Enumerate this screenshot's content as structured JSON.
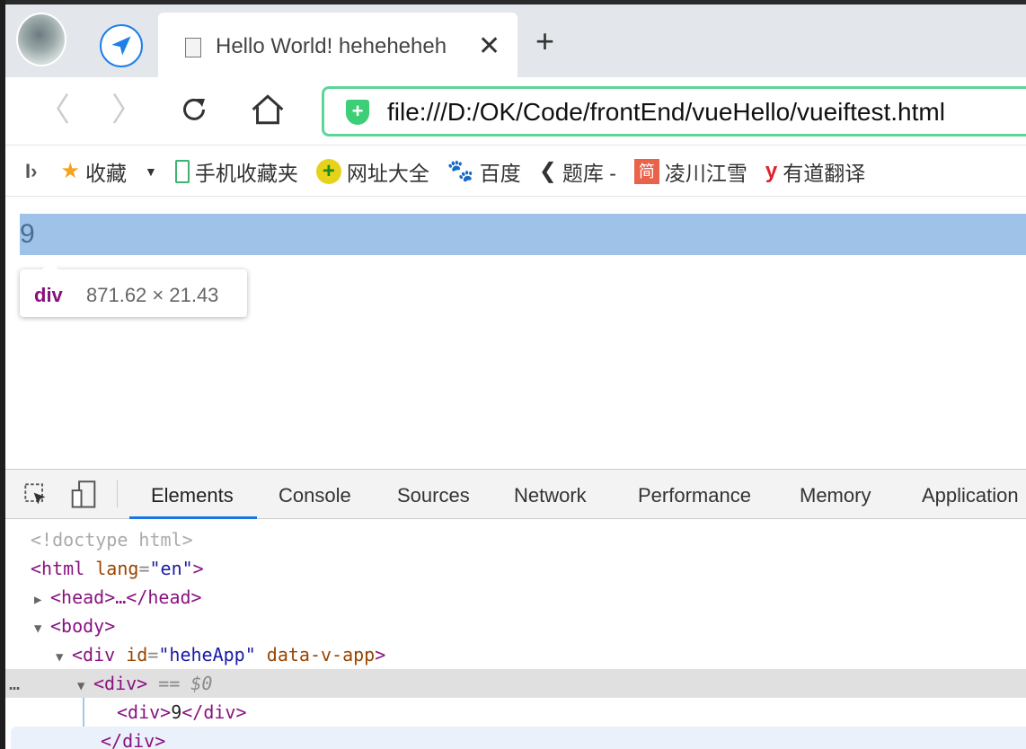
{
  "browser": {
    "tab_title": "Hello World! heheheheh",
    "url": "file:///D:/OK/Code/frontEnd/vueHello/vueiftest.html",
    "bookmarks": [
      {
        "label": "收藏",
        "icon": "star-icon"
      },
      {
        "label": "手机收藏夹",
        "icon": "phone-icon"
      },
      {
        "label": "网址大全",
        "icon": "plus-globe-icon"
      },
      {
        "label": "百度",
        "icon": "baidu-paw-icon"
      },
      {
        "label": "题库 -",
        "icon": "tiku-icon"
      },
      {
        "label": "凌川江雪",
        "icon": "jian-icon"
      },
      {
        "label": "有道翻译",
        "icon": "youdao-icon"
      }
    ]
  },
  "page": {
    "content": "9",
    "tooltip": {
      "tag": "div",
      "size": "871.62 × 21.43"
    }
  },
  "devtools": {
    "tabs": [
      "Elements",
      "Console",
      "Sources",
      "Network",
      "Performance",
      "Memory",
      "Application"
    ],
    "active_tab": "Elements",
    "tree": {
      "doctype": "<!doctype html>",
      "html_open": "<html",
      "lang_attr": "lang",
      "lang_val": "\"en\"",
      "head": "<head>…</head>",
      "body": "<body>",
      "app_div": "<div",
      "id_attr": "id",
      "id_val": "\"heheApp\"",
      "vapp_attr": "data-v-app",
      "sel_div": "<div>",
      "sel_marker": "== $0",
      "inner_div_open": "<div>",
      "inner_text": "9",
      "inner_div_close": "</div>",
      "close_div": "</div>"
    }
  },
  "colors": {
    "accent": "#1a73e8",
    "highlight": "#9fc3e8",
    "url_border": "#5ed49b"
  }
}
